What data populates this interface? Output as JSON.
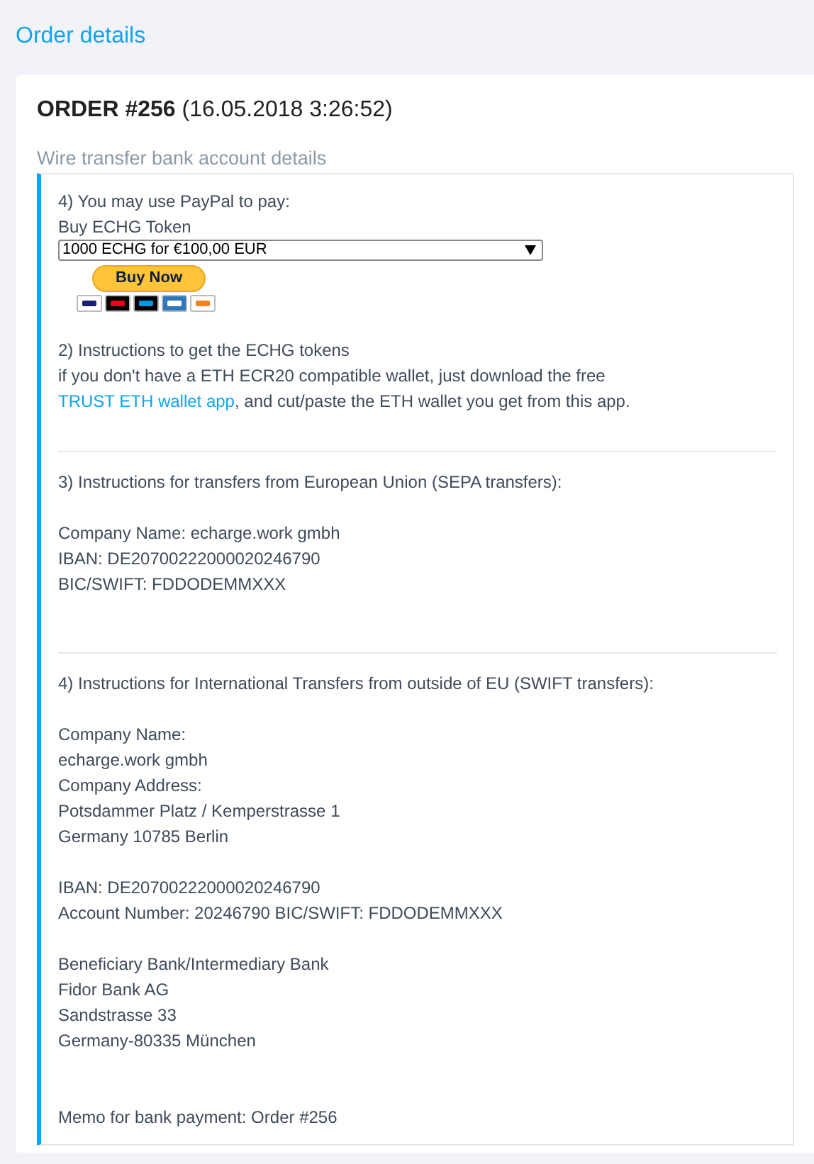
{
  "page_title": "Order details",
  "order": {
    "number": "ORDER #256",
    "date": "(16.05.2018 3:26:52)"
  },
  "subtitle": "Wire transfer bank account details",
  "sections": [
    {
      "kind": "paypal",
      "heading": "4) You may use PayPal to pay:",
      "label": "Buy ECHG Token",
      "select_value": "1000 ECHG for €100,00 EUR",
      "button": "Buy Now",
      "instructions_title": "2) Instructions to get the ECHG tokens",
      "instructions_before": "if you don't have a ETH ECR20 compatible wallet, just download the free",
      "link": "TRUST ETH wallet app",
      "instructions_after": ", and cut/paste the ETH wallet you get from this app."
    },
    {
      "kind": "text",
      "heading": "3) Instructions for transfers from European Union (SEPA transfers):",
      "paragraphs": [
        [
          "Company Name: echarge.work gmbh",
          "IBAN: DE20700222000020246790",
          "BIC/SWIFT: FDDODEMMXXX"
        ]
      ]
    },
    {
      "kind": "text",
      "heading": "4) Instructions for International Transfers from outside of EU (SWIFT transfers):",
      "paragraphs": [
        [
          "Company Name:",
          "echarge.work gmbh",
          "Company Address:",
          "Potsdammer Platz / Kemperstrasse 1",
          "Germany 10785 Berlin"
        ],
        [
          "IBAN: DE20700222000020246790",
          "Account Number: 20246790 BIC/SWIFT: FDDODEMMXXX"
        ],
        [
          "Beneficiary Bank/Intermediary Bank",
          "Fidor Bank AG",
          "Sandstrasse 33",
          "Germany-80335 München"
        ]
      ],
      "memo": "Memo for bank payment: Order #256"
    }
  ]
}
